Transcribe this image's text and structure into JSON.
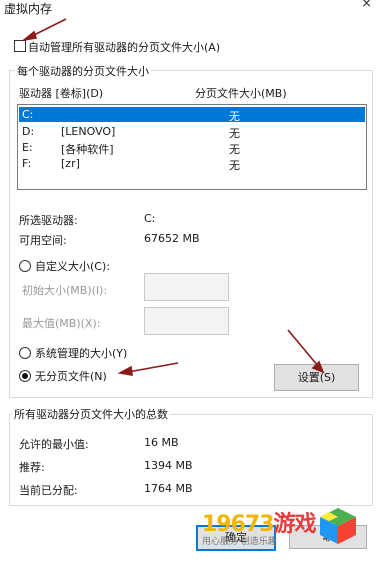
{
  "window": {
    "title": "虚拟内存",
    "close_glyph": "×"
  },
  "auto_manage": {
    "label": "自动管理所有驱动器的分页文件大小(A)",
    "checked": false
  },
  "drives_group": {
    "legend": "每个驱动器的分页文件大小",
    "col_drive": "驱动器 [卷标](D)",
    "col_size": "分页文件大小(MB)",
    "rows": [
      {
        "drive": "C:",
        "label": "",
        "size": "无"
      },
      {
        "drive": "D:",
        "label": "[LENOVO]",
        "size": "无"
      },
      {
        "drive": "E:",
        "label": "[各种软件]",
        "size": "无"
      },
      {
        "drive": "F:",
        "label": "[zr]",
        "size": "无"
      }
    ],
    "selected_drive_label": "所选驱动器:",
    "selected_drive_value": "C:",
    "free_space_label": "可用空间:",
    "free_space_value": "67652 MB",
    "custom_size_label": "自定义大小(C):",
    "initial_size_label": "初始大小(MB)(I):",
    "max_size_label": "最大值(MB)(X):",
    "system_managed_label": "系统管理的大小(Y)",
    "no_paging_label": "无分页文件(N)",
    "set_button": "设置(S)"
  },
  "totals_group": {
    "legend": "所有驱动器分页文件大小的总数",
    "min_allowed_label": "允许的最小值:",
    "min_allowed_value": "16 MB",
    "recommended_label": "推荐:",
    "recommended_value": "1394 MB",
    "current_label": "当前已分配:",
    "current_value": "1764 MB"
  },
  "buttons": {
    "ok": "确定",
    "cancel": "取"
  },
  "watermark": {
    "logo_num": "19673",
    "logo_cn": "游戏",
    "tagline": "用心服务 创造乐趣"
  },
  "colors": {
    "selection": "#0078d7",
    "arrow": "#8b1a1a"
  }
}
